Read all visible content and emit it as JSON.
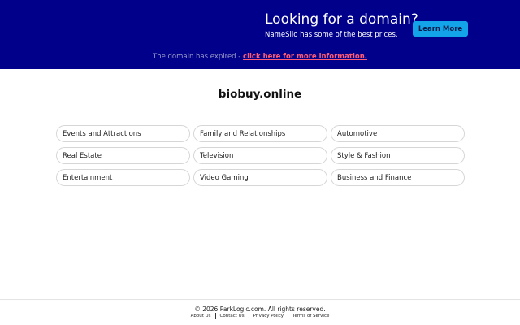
{
  "banner": {
    "promo_title": "Looking for a domain?",
    "promo_subtitle": "NameSilo has some of the best prices.",
    "learn_more_label": "Learn More",
    "expired_text": "The domain has expired - ",
    "expired_link": "click here for more information.",
    "colors": {
      "background": "#00008b",
      "button": "#12a3e8",
      "link": "#ff5b73"
    }
  },
  "domain": {
    "name": "biobuy.online"
  },
  "categories": [
    "Events and Attractions",
    "Family and Relationships",
    "Automotive",
    "Real Estate",
    "Television",
    "Style & Fashion",
    "Entertainment",
    "Video Gaming",
    "Business and Finance"
  ],
  "footer": {
    "copyright": "© 2026 ParkLogic.com. All rights reserved.",
    "links": [
      "About Us",
      "Contact Us",
      "Privacy Policy",
      "Terms of Service"
    ]
  }
}
